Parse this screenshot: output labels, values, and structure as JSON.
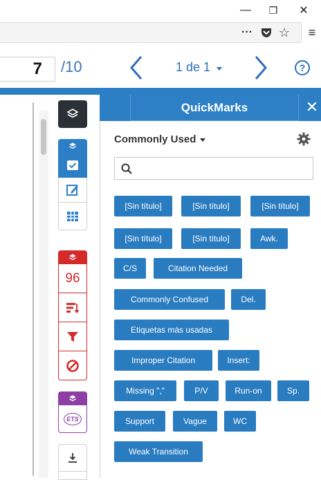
{
  "window": {
    "minimize_glyph": "—",
    "restore_glyph": "❐",
    "close_glyph": "✕"
  },
  "browser_toolbar": {
    "more_glyph": "···",
    "pocket_icon": "pocket-icon",
    "star_glyph": "☆",
    "menu_glyph": "≡"
  },
  "viewer": {
    "current_page": "7",
    "total_pages": "/10",
    "page_of": "1 de 1",
    "help_glyph": "?"
  },
  "quickmarks": {
    "title": "QuickMarks",
    "close_glyph": "✕",
    "set_name": "Commonly Used",
    "search_placeholder": "",
    "marks": [
      "[Sin título]",
      "[Sin título]",
      "[Sin título]",
      "[Sin título]",
      "[Sin título]",
      "Awk.",
      "C/S",
      "Citation Needed",
      "Commonly Confused",
      "Del.",
      "Etiquetas más usadas",
      "Improper Citation",
      "Insert:",
      "Missing \",\"",
      "P/V",
      "Run-on",
      "Sp.",
      "Support",
      "Vague",
      "WC",
      "Weak Transition"
    ]
  },
  "tools": {
    "grading_score": "96",
    "ets_label": "ETS"
  },
  "colors": {
    "accent_blue": "#2c7fc4",
    "grading_red": "#d42a2a",
    "ets_purple": "#8e3fa6",
    "dark_layers": "#333333"
  }
}
